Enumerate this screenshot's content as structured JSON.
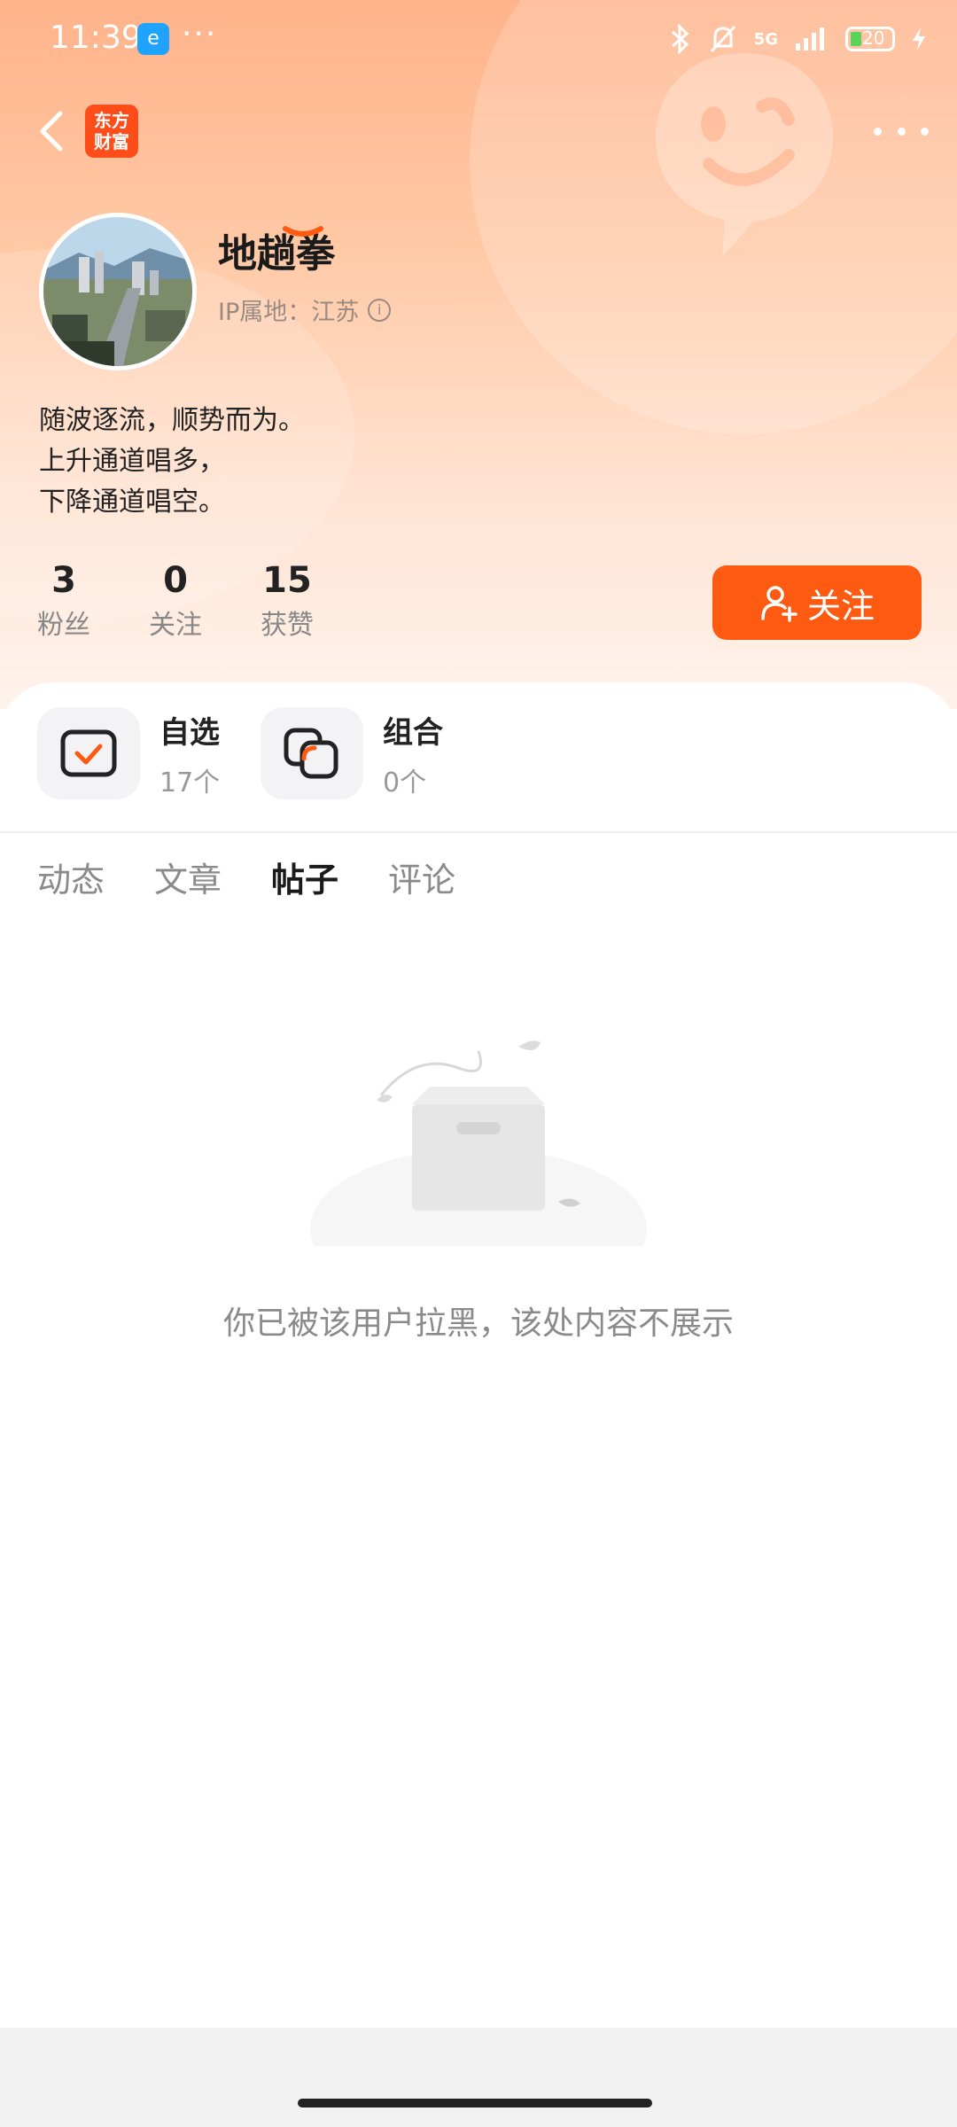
{
  "status_bar": {
    "time": "11:39",
    "app_badge": "e",
    "more": "···",
    "network": "5G",
    "battery_level": "20"
  },
  "header": {
    "brand_logo_line1": "东方",
    "brand_logo_line2": "财富"
  },
  "profile": {
    "username": "地趟拳",
    "ip_location": "IP属地：江苏",
    "bio": [
      "随波逐流，顺势而为。",
      "上升通道唱多，",
      "下降通道唱空。"
    ],
    "stats": [
      {
        "value": "3",
        "label": "粉丝"
      },
      {
        "value": "0",
        "label": "关注"
      },
      {
        "value": "15",
        "label": "获赞"
      }
    ],
    "follow_label": "关注"
  },
  "shortcuts": [
    {
      "title": "自选",
      "count": "17个",
      "icon": "checkbox-icon"
    },
    {
      "title": "组合",
      "count": "0个",
      "icon": "portfolio-icon"
    }
  ],
  "tabs": [
    {
      "label": "动态",
      "active": false
    },
    {
      "label": "文章",
      "active": false
    },
    {
      "label": "帖子",
      "active": true
    },
    {
      "label": "评论",
      "active": false
    }
  ],
  "empty_state": {
    "message": "你已被该用户拉黑，该处内容不展示"
  },
  "colors": {
    "accent": "#ff5a11",
    "hero_top": "#ffb38a"
  }
}
